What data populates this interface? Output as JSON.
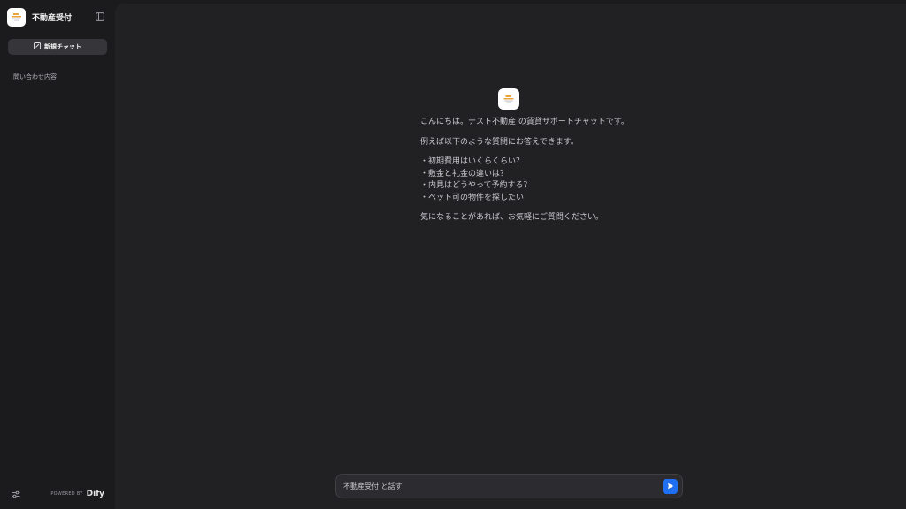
{
  "sidebar": {
    "app_name": "不動産受付",
    "new_chat_label": "新規チャット",
    "conversations": [
      {
        "label": "問い合わせ内容"
      }
    ],
    "footer": {
      "powered_by": "POWERED BY",
      "brand": "Dify"
    }
  },
  "icons": {
    "logo": "building-logo-icon",
    "collapse": "sidebar-collapse-icon",
    "new_chat": "edit-icon",
    "settings": "settings-toggle-icon",
    "send": "send-icon"
  },
  "chat": {
    "welcome": {
      "greeting": "こんにちは。テスト不動産 の賃貸サポートチャットです。",
      "intro": "例えば以下のような質問にお答えできます。",
      "examples": [
        "・初期費用はいくらくらい？",
        "・敷金と礼金の違いは？",
        "・内見はどうやって予約する？",
        "・ペット可の物件を探したい"
      ],
      "closing": "気になることがあれば、お気軽にご質問ください。"
    }
  },
  "input": {
    "placeholder": "不動産受付 と話す"
  },
  "colors": {
    "background": "#1b1b1d",
    "main_panel": "#212124",
    "accent": "#1f6ff5",
    "logo_accent": "#e8a33a"
  }
}
